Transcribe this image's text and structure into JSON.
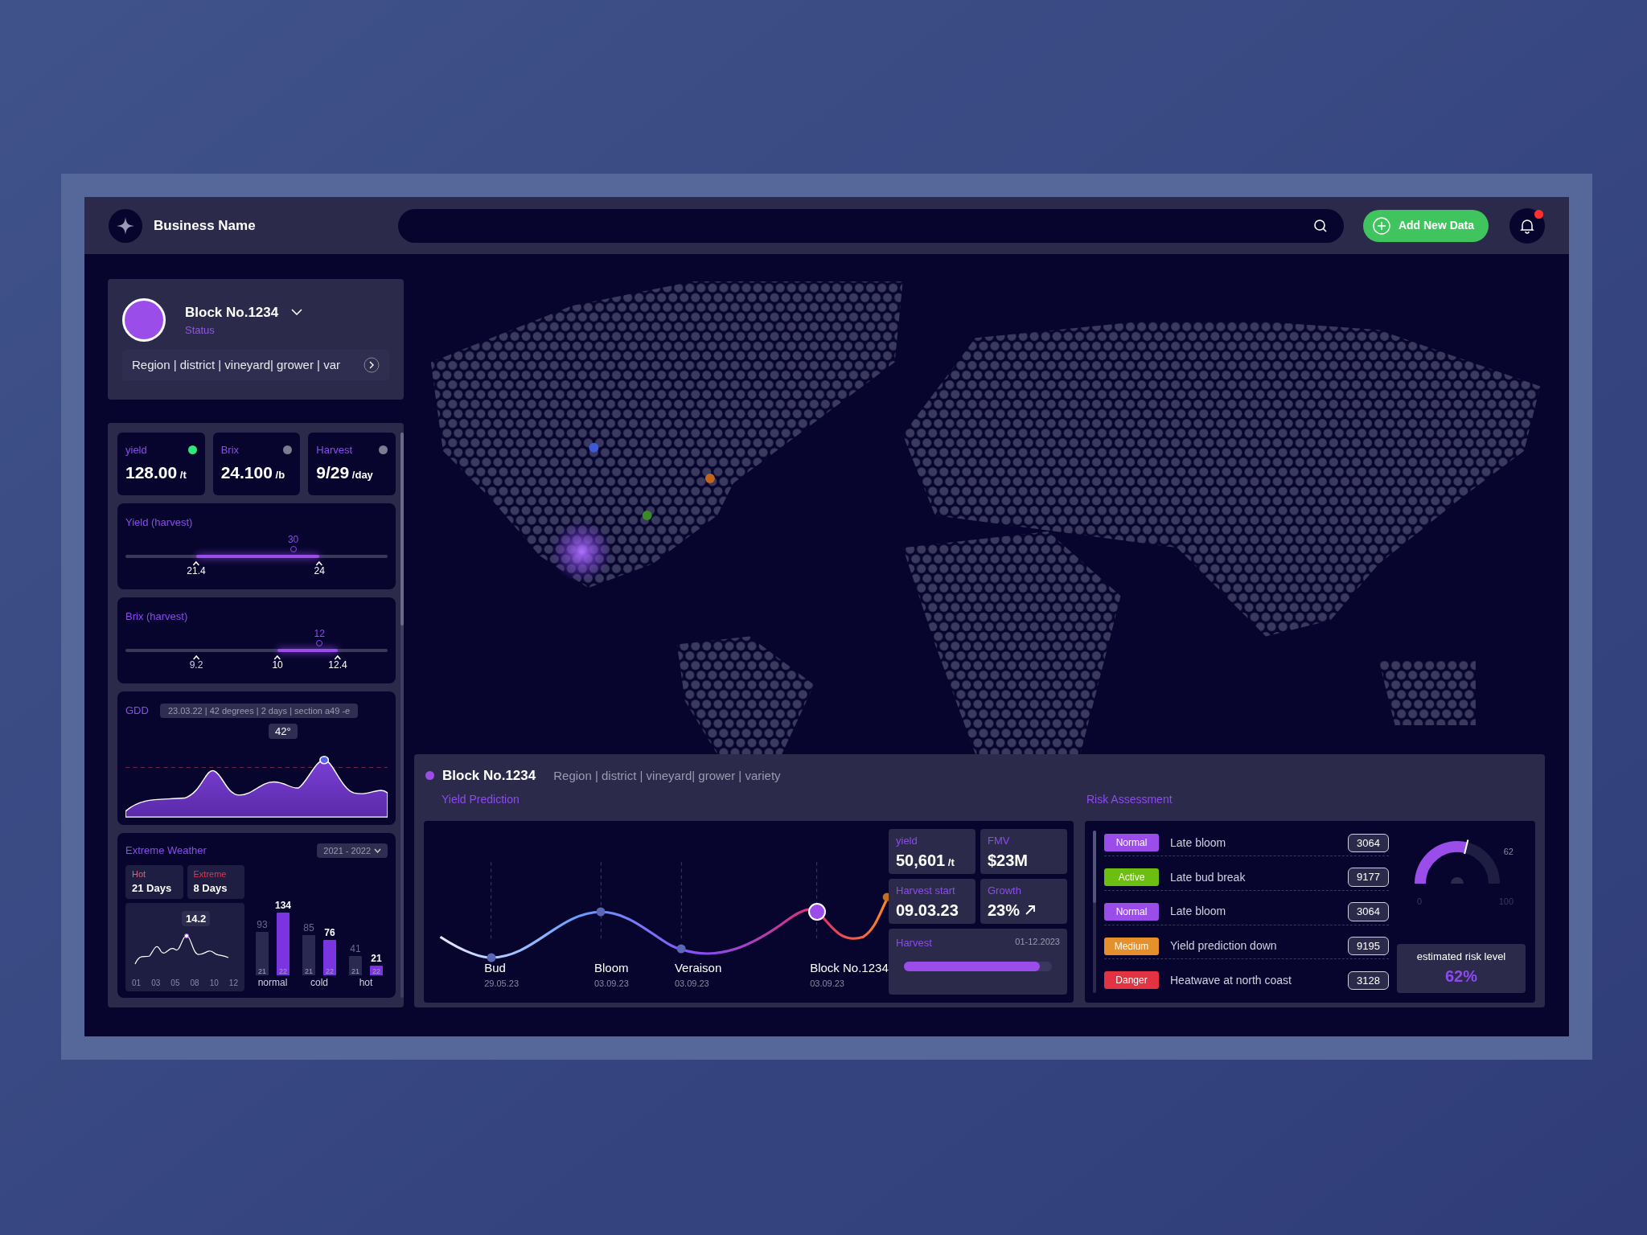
{
  "header": {
    "business_name": "Business Name",
    "add_button": "Add New Data",
    "notification": {
      "unread": true
    }
  },
  "block_card": {
    "title": "Block No.1234",
    "status": "Status",
    "breadcrumb": "Region | district | vineyard| grower | var"
  },
  "stats": [
    {
      "label": "yield",
      "value": "128.00",
      "unit": "/t",
      "color": "#2ee87a"
    },
    {
      "label": "Brix",
      "value": "24.100",
      "unit": "/b",
      "color": "#7c7b90"
    },
    {
      "label": "Harvest",
      "value": "9/29",
      "unit": "/day",
      "color": "#7c7b90"
    }
  ],
  "ranges": [
    {
      "title": "Yield (harvest)",
      "marker": {
        "label": "30",
        "level": 0.64
      },
      "handles": [
        {
          "label": "21.4",
          "level": 0.27,
          "in_range": true
        },
        {
          "label": "24",
          "level": 0.74,
          "in_range": true
        }
      ]
    },
    {
      "title": "Brix (harvest)",
      "marker": {
        "label": "12",
        "level": 0.74
      },
      "handles": [
        {
          "label": "9.2",
          "level": 0.27,
          "in_range": false
        },
        {
          "label": "10",
          "level": 0.58,
          "in_range": true
        },
        {
          "label": "12.4",
          "level": 0.81,
          "in_range": true
        }
      ]
    }
  ],
  "gdd": {
    "title": "GDD",
    "info": "23.03.22 | 42 degrees | 2 days | section a49 -e",
    "tooltip": "42°"
  },
  "extreme_weather": {
    "title": "Extreme Weather",
    "period": "2021 - 2022",
    "counts": [
      {
        "label": "Hot",
        "value": "21 Days",
        "color": "#e0607a"
      },
      {
        "label": "Extreme",
        "value": "8 Days",
        "color": "#e8344a"
      }
    ],
    "trend": {
      "tooltip": "14.2",
      "x_labels": [
        "01",
        "03",
        "05",
        "08",
        "10",
        "12"
      ]
    },
    "chart_data": {
      "type": "bar",
      "categories": [
        "normal",
        "cold",
        "hot"
      ],
      "series": [
        {
          "name": "21",
          "color": "#2a2950",
          "values": [
            93,
            85,
            41
          ]
        },
        {
          "name": "22",
          "color": "#7a35e0",
          "values": [
            134,
            76,
            21
          ]
        }
      ],
      "data_labels": true
    }
  },
  "detail": {
    "title": "Block No.1234",
    "path": "Region | district | vineyard| grower | variety",
    "yield_title": "Yield Prediction",
    "risk_title": "Risk Assessment",
    "stages": [
      {
        "label": "Bud",
        "date": "29.05.23",
        "current": false
      },
      {
        "label": "Bloom",
        "date": "03.09.23",
        "current": false
      },
      {
        "label": "Veraison",
        "date": "03.09.23",
        "current": false
      },
      {
        "label": "Block No.1234",
        "date": "03.09.23",
        "current": true
      }
    ],
    "metrics": [
      {
        "label": "yield",
        "value": "50,601",
        "unit": "/t",
        "trend_up": false
      },
      {
        "label": "FMV",
        "value": "$23M",
        "trend_up": false
      },
      {
        "label": "Harvest start",
        "value": "09.03.23",
        "trend_up": false
      },
      {
        "label": "Growth",
        "value": "23%",
        "trend_up": true
      }
    ],
    "harvest": {
      "label": "Harvest",
      "date": "01-12.2023",
      "level": 0.92
    },
    "risks": [
      {
        "tag": "Normal",
        "color": "#9b4dea",
        "text": "Late bloom",
        "value": "3064"
      },
      {
        "tag": "Active",
        "color": "#6cbf10",
        "text": "Late bud break",
        "value": "9177"
      },
      {
        "tag": "Normal",
        "color": "#9b4dea",
        "text": "Late bloom",
        "value": "3064"
      },
      {
        "tag": "Medium",
        "color": "#e5902a",
        "text": "Yield prediction down",
        "value": "9195"
      },
      {
        "tag": "Danger",
        "color": "#e23342",
        "text": "Heatwave at north coast",
        "value": "3128"
      }
    ],
    "gauge": {
      "level": 0.62,
      "reading": "62",
      "min": "0",
      "max": "100",
      "caption": "estimated risk level",
      "value": "62%"
    }
  }
}
